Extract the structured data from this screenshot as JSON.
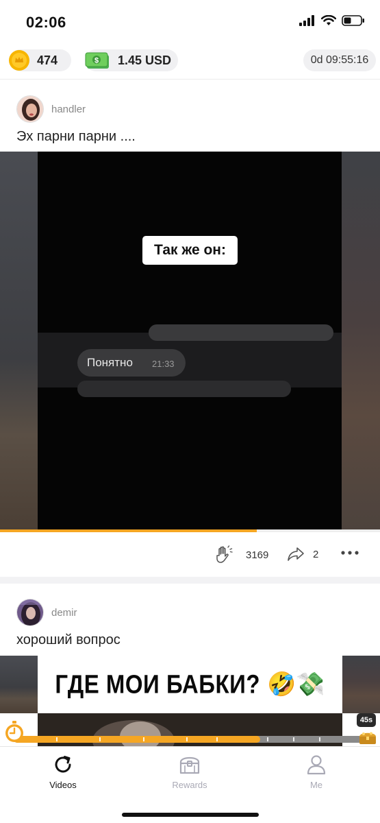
{
  "status_bar": {
    "time": "02:06"
  },
  "balance": {
    "coins": "474",
    "cash": "1.45 USD",
    "countdown": "0d 09:55:16"
  },
  "posts": [
    {
      "username": "handler",
      "caption": "Эх парни парни ....",
      "video_overlay": "Так же он:",
      "chat_message": "Понятно",
      "chat_time": "21:33",
      "progress_fraction": 0.675,
      "likes": "3169",
      "shares": "2"
    },
    {
      "username": "demir",
      "caption": "хороший вопрос",
      "banner_text": "ГДЕ МОИ БАБКИ?",
      "banner_emoji": "🤣💸"
    }
  ],
  "reward": {
    "progress_fraction": 0.705,
    "seconds_badge": "45s"
  },
  "nav": {
    "items": [
      {
        "label": "Videos",
        "icon": "refresh-icon",
        "active": true
      },
      {
        "label": "Rewards",
        "icon": "treasure-chest-icon",
        "active": false
      },
      {
        "label": "Me",
        "icon": "person-icon",
        "active": false
      }
    ]
  },
  "colors": {
    "accent": "#f5a623",
    "inactive_nav": "#a9a9b5",
    "active_nav": "#111111"
  }
}
